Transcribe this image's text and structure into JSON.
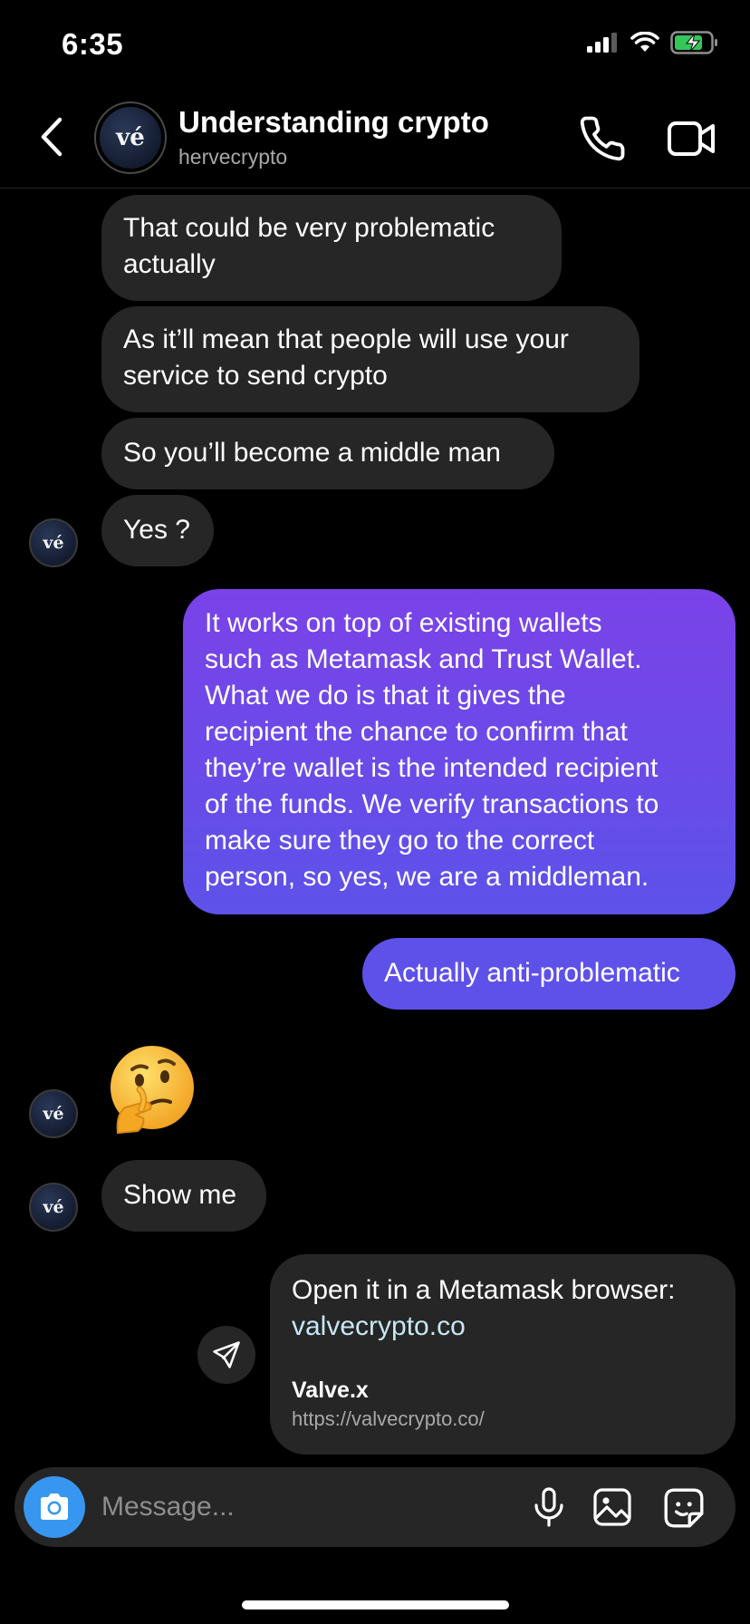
{
  "status_bar": {
    "time": "6:35"
  },
  "header": {
    "avatar_text": "vé",
    "title": "Understanding crypto",
    "username": "hervecrypto"
  },
  "messages": [
    {
      "direction": "incoming",
      "lines": [
        "That could be very problematic",
        "actually"
      ]
    },
    {
      "direction": "incoming",
      "lines": [
        "As it’ll mean that people will use your",
        "service to send crypto"
      ]
    },
    {
      "direction": "incoming",
      "lines": [
        "So you’ll become a middle man"
      ]
    },
    {
      "direction": "incoming",
      "lines": [
        "Yes ?"
      ]
    },
    {
      "direction": "outgoing",
      "lines": [
        "It works on top of existing wallets",
        "such as Metamask and Trust Wallet.",
        "What we do is that it gives the",
        "recipient the chance to confirm that",
        "they’re wallet is the intended recipient",
        "of the funds. We verify transactions to",
        "make sure they go to the correct",
        "person, so yes, we are a middleman."
      ]
    },
    {
      "direction": "outgoing",
      "lines": [
        "Actually anti-problematic"
      ]
    },
    {
      "direction": "incoming",
      "emoji": "thinking-face"
    },
    {
      "direction": "incoming",
      "lines": [
        "Show me"
      ]
    },
    {
      "direction": "outgoing",
      "text": "Open it in a Metamask browser:",
      "link": "valvecrypto.co",
      "preview_title": "Valve.x",
      "preview_url": "https://valvecrypto.co/"
    }
  ],
  "composer": {
    "placeholder": "Message..."
  },
  "colors": {
    "background": "#000000",
    "incoming_bubble": "#262626",
    "outgoing_bubble": "#5e51ea",
    "outgoing_gradient_top": "#7a42e8",
    "camera_button": "#3797f0",
    "battery_charging": "#34c759"
  },
  "icons": [
    "back-icon",
    "phone-icon",
    "video-camera-icon",
    "send-icon",
    "camera-icon",
    "microphone-icon",
    "image-icon",
    "sticker-icon",
    "signal-icon",
    "wifi-icon",
    "battery-charging-icon"
  ]
}
